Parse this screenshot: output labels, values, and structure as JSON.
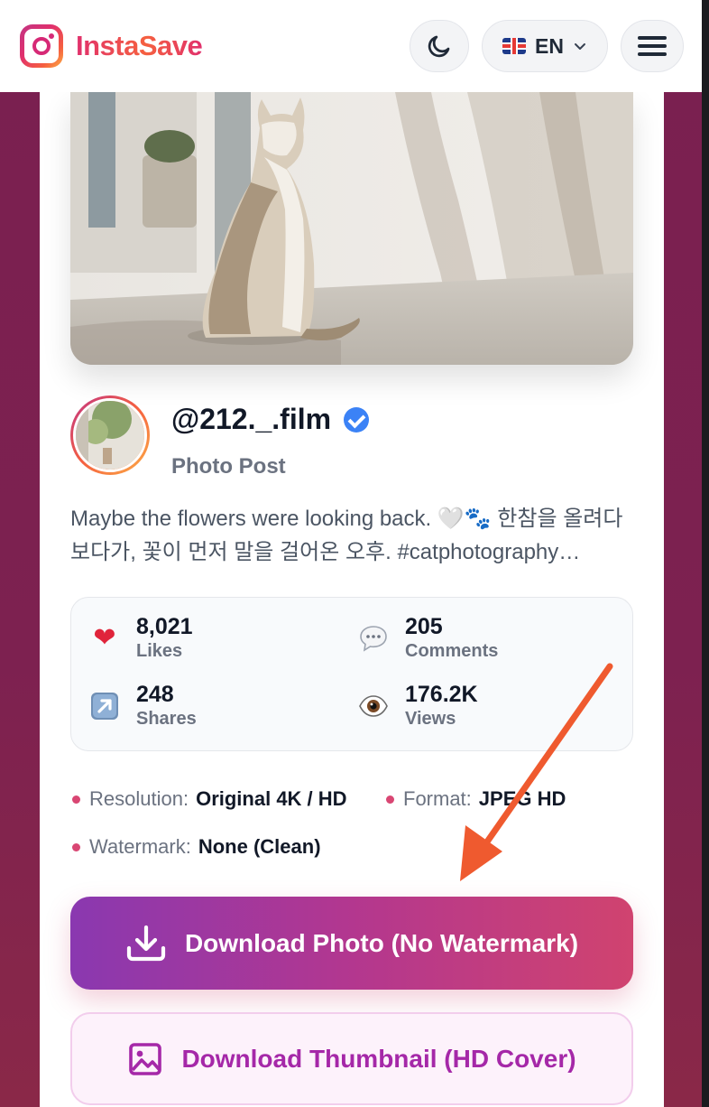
{
  "header": {
    "brand": "InstaSave",
    "language": "EN"
  },
  "post": {
    "handle": "@212._.film",
    "type": "Photo Post",
    "caption": "Maybe the flowers were looking back. 🤍🐾 한참을 올려다보다가, 꽃이 먼저 말을 걸어온 오후. #catphotography…"
  },
  "stats": [
    {
      "icon": "heart-icon",
      "value": "8,021",
      "label": "Likes"
    },
    {
      "icon": "comment-icon",
      "value": "205",
      "label": "Comments"
    },
    {
      "icon": "share-icon",
      "value": "248",
      "label": "Shares"
    },
    {
      "icon": "eye-icon",
      "value": "176.2K",
      "label": "Views"
    }
  ],
  "meta": {
    "resolution_label": "Resolution:",
    "resolution_value": "Original 4K / HD",
    "format_label": "Format:",
    "format_value": "JPEG HD",
    "watermark_label": "Watermark:",
    "watermark_value": "None (Clean)"
  },
  "actions": {
    "download_photo": "Download Photo (No Watermark)",
    "download_thumbnail": "Download Thumbnail (HD Cover)"
  },
  "colors": {
    "accent": "#d0436f",
    "accent_purple": "#8a38b0",
    "arrow": "#ef5a2f",
    "verified": "#3b82f6"
  }
}
